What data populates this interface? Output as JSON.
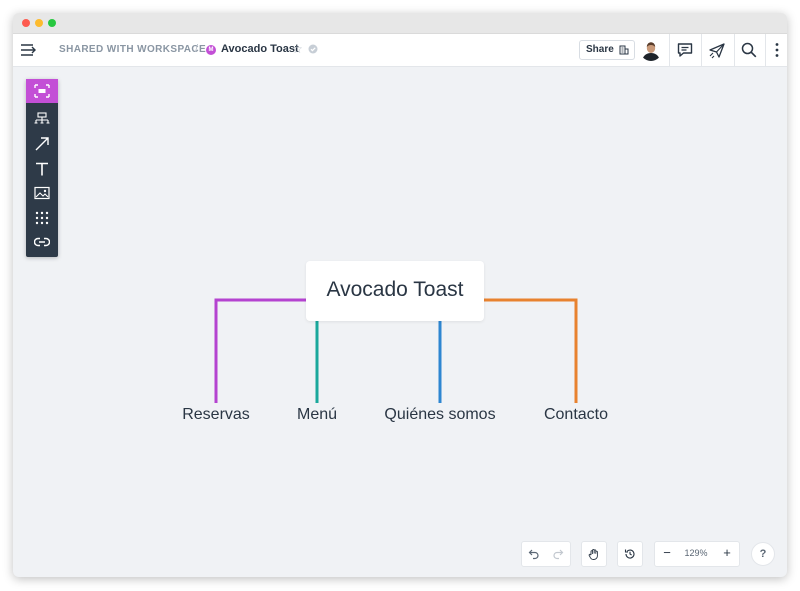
{
  "header": {
    "workspace_label": "SHARED WITH WORKSPACE",
    "separator": "/",
    "doc_badge": "M",
    "doc_title": "Avocado Toast",
    "share_label": "Share",
    "icons": [
      "menu-toggle-icon",
      "star-icon",
      "check-circle-icon",
      "building-icon",
      "comment-icon",
      "paper-plane-icon",
      "search-icon",
      "more-vertical-icon"
    ]
  },
  "toolbar": {
    "tools": [
      "select-frame-icon",
      "topic-icon",
      "arrow-icon",
      "text-icon",
      "image-icon",
      "grid-icon",
      "link-icon"
    ],
    "active_color": "#c34fd6"
  },
  "mindmap": {
    "central": "Avocado Toast",
    "branches": [
      {
        "label": "Reservas",
        "color": "#b443d0"
      },
      {
        "label": "Menú",
        "color": "#1aa89c"
      },
      {
        "label": "Quiénes somos",
        "color": "#2e86d1"
      },
      {
        "label": "Contacto",
        "color": "#e8822f"
      }
    ]
  },
  "bottom": {
    "zoom": "129%",
    "zoom_out": "−",
    "zoom_in": "+",
    "help": "?",
    "icons": [
      "undo-icon",
      "redo-icon",
      "hand-icon",
      "history-icon"
    ]
  }
}
